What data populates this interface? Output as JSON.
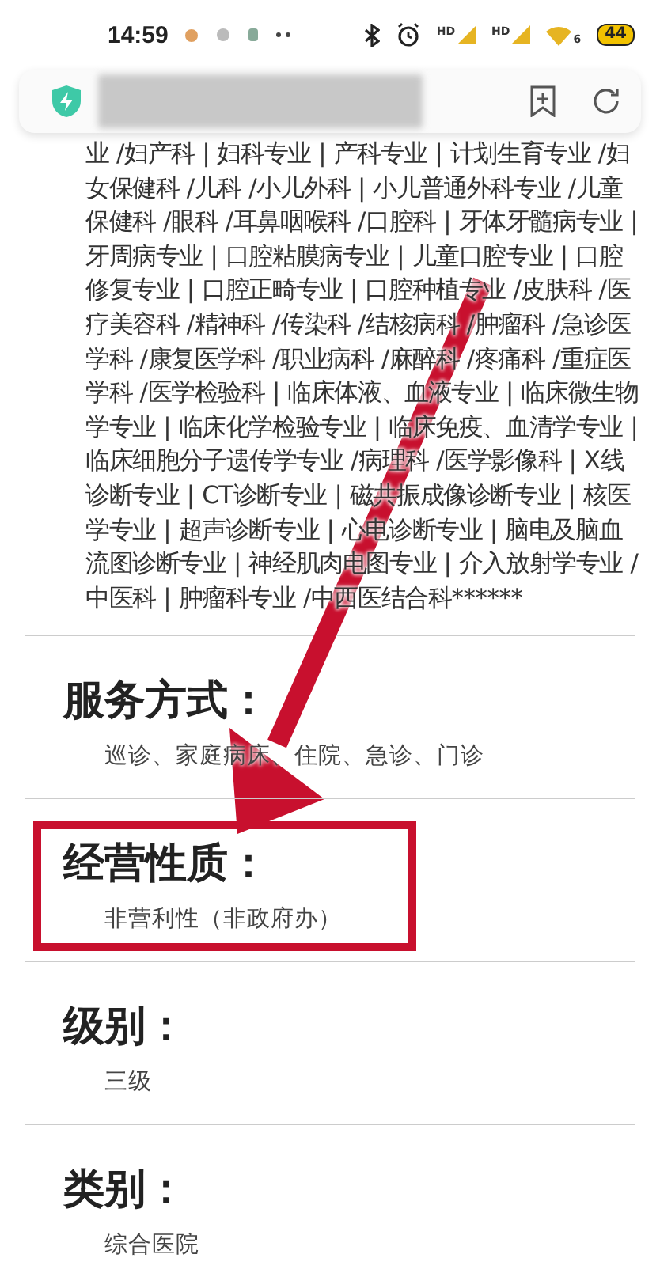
{
  "status_bar": {
    "time": "14:59",
    "signal_labels": [
      "HD",
      "HD"
    ],
    "wifi_label": "6",
    "battery": "44"
  },
  "departments_text": "业 /妇产科 | 妇科专业 | 产科专业 | 计划生育专业 /妇女保健科 /儿科 /小儿外科 | 小儿普通外科专业 /儿童保健科 /眼科 /耳鼻咽喉科 /口腔科 | 牙体牙髓病专业 | 牙周病专业 | 口腔粘膜病专业 | 儿童口腔专业 | 口腔修复专业 | 口腔正畸专业 | 口腔种植专业 /皮肤科 /医疗美容科 /精神科 /传染科 /结核病科 /肿瘤科 /急诊医学科 /康复医学科 /职业病科 /麻醉科 /疼痛科 /重症医学科 /医学检验科 | 临床体液、血液专业 | 临床微生物学专业 | 临床化学检验专业 | 临床免疫、血清学专业 | 临床细胞分子遗传学专业 /病理科 /医学影像科 | X线诊断专业 | CT诊断专业 | 磁共振成像诊断专业 | 核医学专业 | 超声诊断专业 | 心电诊断专业 | 脑电及脑血流图诊断专业 | 神经肌肉电图专业 | 介入放射学专业 /中医科 | 肿瘤科专业 /中西医结合科******",
  "sections": [
    {
      "heading": "服务方式：",
      "value": "巡诊、家庭病床、住院、急诊、门诊",
      "highlighted": false
    },
    {
      "heading": "经营性质：",
      "value": "非营利性（非政府办）",
      "highlighted": true
    },
    {
      "heading": "级别：",
      "value": "三级",
      "highlighted": false
    },
    {
      "heading": "类别：",
      "value": "综合医院",
      "highlighted": false
    }
  ],
  "annotation_arrow": true
}
